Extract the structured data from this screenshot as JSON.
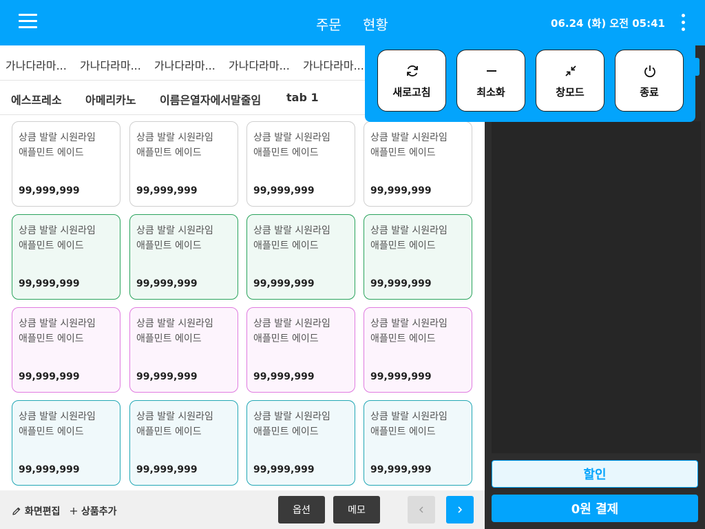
{
  "header": {
    "tabs": [
      "주문",
      "현황"
    ],
    "datetime": "06.24 (화) 오전 05:41"
  },
  "category_row1": [
    "가나다라마...",
    "가나다라마...",
    "가나다라마...",
    "가나다라마...",
    "가나다라마..."
  ],
  "category_row2": [
    "에스프레소",
    "아메리카노",
    "이름은열자에서말줄임",
    "tab 1"
  ],
  "products": {
    "name_line1": "상큼 발랄 시원라임",
    "name_line2": "애플민트 에이드",
    "price": "99,999,999"
  },
  "bottombar": {
    "edit_label": "화면편집",
    "add_label": "상품추가",
    "option_label": "옵션",
    "memo_label": "메모"
  },
  "right_panel": {
    "discount_label": "할인",
    "pay_label": "0원 결제"
  },
  "popup": {
    "refresh_label": "새로고침",
    "minimize_label": "최소화",
    "window_label": "창모드",
    "exit_label": "종료"
  },
  "colors": {
    "accent": "#03a4fc",
    "green": "#2aa35c",
    "pink": "#e07be0",
    "cyan": "#22a7b5"
  },
  "icons": [
    "menu-icon",
    "more-vert-icon",
    "refresh-icon",
    "minus-icon",
    "compress-icon",
    "power-icon",
    "pencil-icon",
    "plus-icon",
    "chevron-left-icon",
    "chevron-right-icon"
  ]
}
